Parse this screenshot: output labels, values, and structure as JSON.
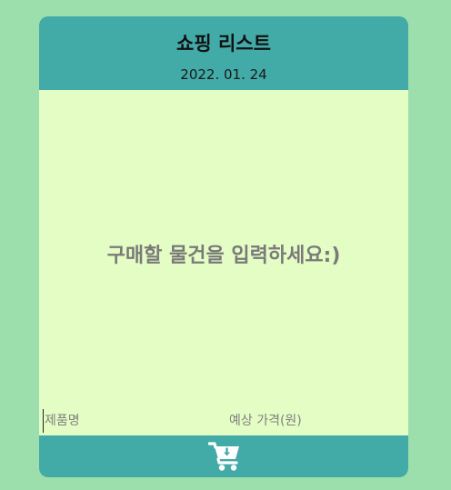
{
  "header": {
    "title": "쇼핑 리스트",
    "date": "2022. 01. 24"
  },
  "list": {
    "empty_message": "구매할 물건을 입력하세요:)"
  },
  "inputs": {
    "name_placeholder": "제품명",
    "name_value": "",
    "price_placeholder": "예상 가격(원)",
    "price_value": ""
  },
  "footer": {
    "add_icon": "cart-add-icon"
  },
  "colors": {
    "page_background": "#9cdfac",
    "header_footer": "#42aaa7",
    "list_background": "#e4fdc4",
    "message_text": "#7a7a7a"
  }
}
